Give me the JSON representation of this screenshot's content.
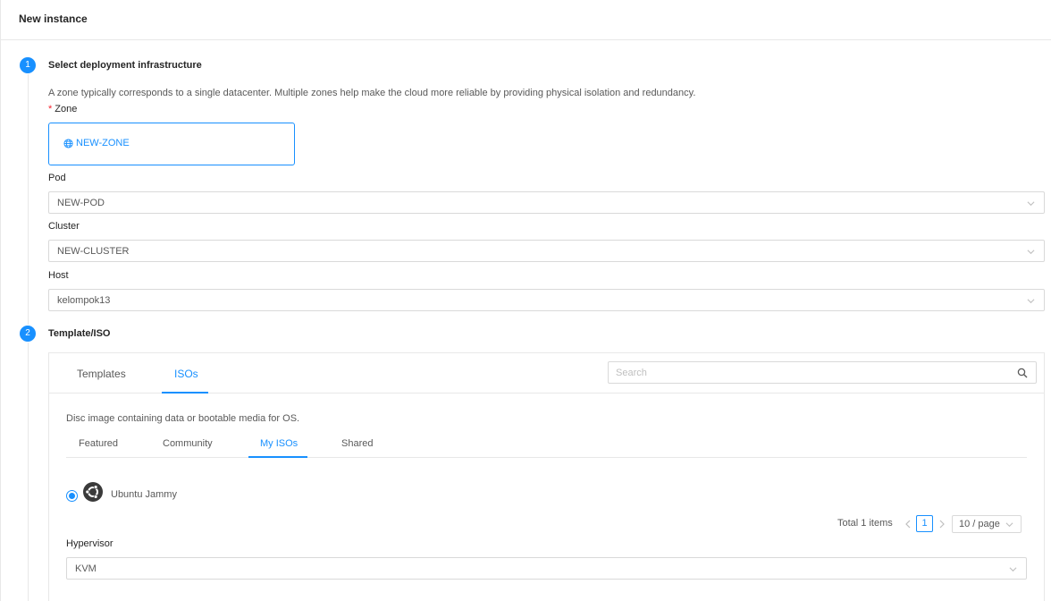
{
  "header": {
    "title": "New instance"
  },
  "steps": [
    {
      "number": "1",
      "title": "Select deployment infrastructure"
    },
    {
      "number": "2",
      "title": "Template/ISO"
    }
  ],
  "infrastructure": {
    "description": "A zone typically corresponds to a single datacenter. Multiple zones help make the cloud more reliable by providing physical isolation and redundancy.",
    "zone_label": "Zone",
    "zone_required_mark": "*",
    "zone_value": "NEW-ZONE",
    "pod_label": "Pod",
    "pod_value": "NEW-POD",
    "cluster_label": "Cluster",
    "cluster_value": "NEW-CLUSTER",
    "host_label": "Host",
    "host_value": "kelompok13"
  },
  "template_iso": {
    "tabs": [
      {
        "label": "Templates",
        "active": false
      },
      {
        "label": "ISOs",
        "active": true
      }
    ],
    "search_placeholder": "Search",
    "description": "Disc image containing data or bootable media for OS.",
    "subtabs": [
      {
        "label": "Featured",
        "active": false
      },
      {
        "label": "Community",
        "active": false
      },
      {
        "label": "My ISOs",
        "active": true
      },
      {
        "label": "Shared",
        "active": false
      }
    ],
    "items": [
      {
        "name": "Ubuntu Jammy",
        "icon": "ubuntu-icon",
        "selected": true
      }
    ],
    "pagination": {
      "total_text": "Total 1 items",
      "current_page": "1",
      "page_size": "10 / page"
    },
    "hypervisor_label": "Hypervisor",
    "hypervisor_value": "KVM"
  },
  "colors": {
    "accent": "#1890ff",
    "border": "#d9d9d9",
    "required": "#f5222d"
  }
}
